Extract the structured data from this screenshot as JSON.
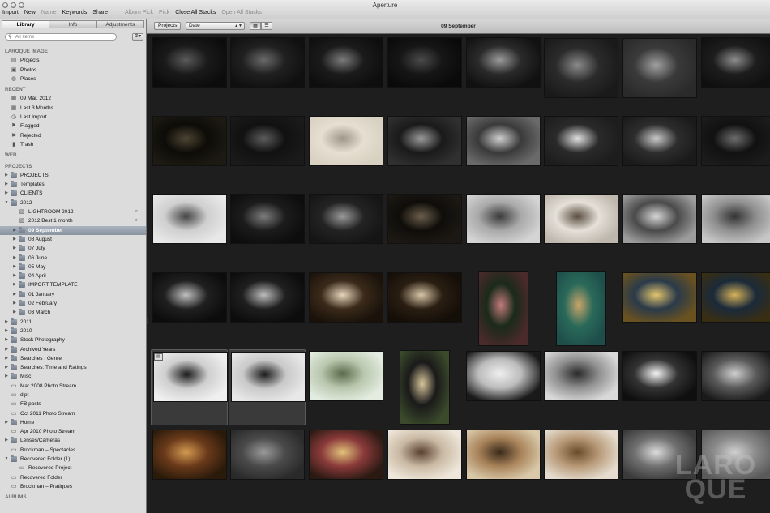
{
  "window": {
    "title": "Aperture"
  },
  "toolbar": [
    {
      "label": "Import",
      "enabled": true
    },
    {
      "label": "New",
      "enabled": true
    },
    {
      "label": "Name",
      "enabled": false
    },
    {
      "label": "Keywords",
      "enabled": true
    },
    {
      "label": "Share",
      "enabled": true
    },
    {
      "label": "Album Pick",
      "enabled": false
    },
    {
      "label": "Pick",
      "enabled": false
    },
    {
      "label": "Close All Stacks",
      "enabled": true
    },
    {
      "label": "Open All Stacks",
      "enabled": false
    }
  ],
  "sidebar": {
    "tabs": [
      {
        "label": "Library",
        "active": true
      },
      {
        "label": "Info",
        "active": false
      },
      {
        "label": "Adjustments",
        "active": false
      }
    ],
    "search_placeholder": "All Items",
    "action_icon": "gear-icon",
    "sections": [
      {
        "title": "LAROQUE IMAGE",
        "rows": [
          {
            "label": "Projects",
            "icon": "projects-icon",
            "indent": 0
          },
          {
            "label": "Photos",
            "icon": "photos-icon",
            "indent": 0
          },
          {
            "label": "Places",
            "icon": "globe-icon",
            "indent": 0
          }
        ]
      },
      {
        "title": "RECENT",
        "rows": [
          {
            "label": "09 Mar, 2012",
            "icon": "calendar-icon",
            "indent": 0
          },
          {
            "label": "Last 3 Months",
            "icon": "calendar-icon",
            "indent": 0
          },
          {
            "label": "Last Import",
            "icon": "clock-icon",
            "indent": 0
          },
          {
            "label": "Flagged",
            "icon": "flag-icon",
            "indent": 0
          },
          {
            "label": "Rejected",
            "icon": "x-icon",
            "indent": 0
          },
          {
            "label": "Trash",
            "icon": "trash-icon",
            "indent": 0
          }
        ]
      },
      {
        "title": "WEB",
        "rows": []
      },
      {
        "title": "PROJECTS",
        "rows": [
          {
            "label": "PROJECTS",
            "icon": "folder-icon",
            "indent": 0,
            "disclosure": "closed"
          },
          {
            "label": "Templates",
            "icon": "folder-icon",
            "indent": 0,
            "disclosure": "closed"
          },
          {
            "label": "CLIENTS",
            "icon": "folder-icon",
            "indent": 0,
            "disclosure": "closed"
          },
          {
            "label": "2012",
            "icon": "folder-icon",
            "indent": 0,
            "disclosure": "open"
          },
          {
            "label": "LIGHTROOM 2012",
            "icon": "smart-album-icon",
            "indent": 1,
            "search": true
          },
          {
            "label": "2012 Best 1 month",
            "icon": "smart-album-icon",
            "indent": 1,
            "search": true
          },
          {
            "label": "09 September",
            "icon": "folder-icon",
            "indent": 1,
            "disclosure": "closed",
            "selected": true
          },
          {
            "label": "08 August",
            "icon": "folder-icon",
            "indent": 1,
            "disclosure": "closed"
          },
          {
            "label": "07 July",
            "icon": "folder-icon",
            "indent": 1,
            "disclosure": "closed"
          },
          {
            "label": "06 June",
            "icon": "folder-icon",
            "indent": 1,
            "disclosure": "closed"
          },
          {
            "label": "05 May",
            "icon": "folder-icon",
            "indent": 1,
            "disclosure": "closed"
          },
          {
            "label": "04 April",
            "icon": "folder-icon",
            "indent": 1,
            "disclosure": "closed"
          },
          {
            "label": "IMPORT TEMPLATE",
            "icon": "folder-icon",
            "indent": 1,
            "disclosure": "closed"
          },
          {
            "label": "01 January",
            "icon": "folder-icon",
            "indent": 1,
            "disclosure": "closed"
          },
          {
            "label": "02 February",
            "icon": "folder-icon",
            "indent": 1,
            "disclosure": "closed"
          },
          {
            "label": "03 March",
            "icon": "folder-icon",
            "indent": 1,
            "disclosure": "closed"
          },
          {
            "label": "2011",
            "icon": "folder-icon",
            "indent": 0,
            "disclosure": "closed"
          },
          {
            "label": "2010",
            "icon": "folder-icon",
            "indent": 0,
            "disclosure": "closed"
          },
          {
            "label": "Stock Photography",
            "icon": "folder-icon",
            "indent": 0,
            "disclosure": "closed"
          },
          {
            "label": "Archived Years",
            "icon": "folder-icon",
            "indent": 0,
            "disclosure": "closed"
          },
          {
            "label": "Searches : Genre",
            "icon": "folder-icon",
            "indent": 0,
            "disclosure": "closed"
          },
          {
            "label": "Searches: Time and Ratings",
            "icon": "folder-icon",
            "indent": 0,
            "disclosure": "closed"
          },
          {
            "label": "Misc",
            "icon": "folder-icon",
            "indent": 0,
            "disclosure": "closed"
          },
          {
            "label": "Mar 2008 Photo Stream",
            "icon": "project-icon",
            "indent": 0
          },
          {
            "label": "dipt",
            "icon": "project-icon",
            "indent": 0
          },
          {
            "label": "FB posts",
            "icon": "project-icon",
            "indent": 0
          },
          {
            "label": "Oct 2011 Photo Stream",
            "icon": "project-icon",
            "indent": 0
          },
          {
            "label": "Home",
            "icon": "folder-icon",
            "indent": 0,
            "disclosure": "closed"
          },
          {
            "label": "Apr 2010 Photo Stream",
            "icon": "project-icon",
            "indent": 0
          },
          {
            "label": "Lenses/Cameras",
            "icon": "folder-icon",
            "indent": 0,
            "disclosure": "closed"
          },
          {
            "label": "Brockman – Spectacles",
            "icon": "project-icon",
            "indent": 0
          },
          {
            "label": "Recovered Folder (1)",
            "icon": "folder-icon",
            "indent": 0,
            "disclosure": "open"
          },
          {
            "label": "Recovered Project",
            "icon": "project-icon",
            "indent": 1
          },
          {
            "label": "Recovered Folder",
            "icon": "project-icon",
            "indent": 0
          },
          {
            "label": "Brockman – Pratiques",
            "icon": "project-icon",
            "indent": 0
          }
        ]
      },
      {
        "title": "ALBUMS",
        "rows": []
      }
    ]
  },
  "browser": {
    "projects_button": "Projects",
    "sort_value": "Date",
    "view_buttons": [
      {
        "icon": "grid-view-icon",
        "active": true
      },
      {
        "icon": "list-view-icon",
        "active": false
      }
    ],
    "folder_title": "09 September",
    "watermark": [
      "LARO",
      "QUE"
    ]
  },
  "thumbnails": [
    [
      {
        "orientation": "landscape",
        "tone": [
          "#0c0c0c",
          "#5a5a5a",
          "#1a1a1a"
        ]
      },
      {
        "orientation": "landscape",
        "tone": [
          "#101010",
          "#6a6a6a",
          "#202020"
        ]
      },
      {
        "orientation": "landscape",
        "tone": [
          "#0e0e0e",
          "#7b7b7b",
          "#1b1b1b"
        ]
      },
      {
        "orientation": "landscape",
        "tone": [
          "#0a0a0a",
          "#4a4a4a",
          "#161616"
        ]
      },
      {
        "orientation": "landscape",
        "tone": [
          "#111111",
          "#9a9a9a",
          "#2a2a2a"
        ]
      },
      {
        "orientation": "square",
        "tone": [
          "#1a1a1a",
          "#8a8a8a",
          "#2b2b2b"
        ]
      },
      {
        "orientation": "square",
        "tone": [
          "#2a2a2a",
          "#a0a0a0",
          "#3a3a3a"
        ]
      },
      {
        "orientation": "landscape",
        "tone": [
          "#101010",
          "#8d8d8d",
          "#1d1d1d"
        ]
      }
    ],
    [
      {
        "orientation": "landscape",
        "tone": [
          "#1c1a12",
          "#4d4432",
          "#0d0c08"
        ]
      },
      {
        "orientation": "landscape",
        "tone": [
          "#1a1a1a",
          "#5c5c5c",
          "#111111"
        ]
      },
      {
        "orientation": "landscape",
        "tone": [
          "#d8d0c0",
          "#9f968a",
          "#e6dfd2"
        ]
      },
      {
        "orientation": "landscape",
        "tone": [
          "#303030",
          "#9a9a9a",
          "#1a1a1a"
        ]
      },
      {
        "orientation": "landscape",
        "tone": [
          "#6a6a6a",
          "#cfcfcf",
          "#3a3a3a"
        ]
      },
      {
        "orientation": "landscape",
        "tone": [
          "#1d1d1d",
          "#e0e0e0",
          "#2a2a2a"
        ]
      },
      {
        "orientation": "landscape",
        "tone": [
          "#1a1a1a",
          "#c9c9c9",
          "#2d2d2d"
        ]
      },
      {
        "orientation": "landscape",
        "tone": [
          "#1c1c1c",
          "#6d6d6d",
          "#111111"
        ]
      }
    ],
    [
      {
        "orientation": "landscape",
        "tone": [
          "#e8e8e8",
          "#444444",
          "#cfcfcf"
        ]
      },
      {
        "orientation": "landscape",
        "tone": [
          "#0d0d0d",
          "#7d7d7d",
          "#1c1c1c"
        ]
      },
      {
        "orientation": "landscape",
        "tone": [
          "#151515",
          "#9a9a9a",
          "#232323"
        ]
      },
      {
        "orientation": "landscape",
        "tone": [
          "#1c1914",
          "#6b5e4c",
          "#0f0d0a"
        ]
      },
      {
        "orientation": "landscape",
        "tone": [
          "#d4d4d4",
          "#3a3a3a",
          "#a9a9a9"
        ]
      },
      {
        "orientation": "landscape",
        "tone": [
          "#bdb7ad",
          "#5a4e40",
          "#e5e0d8"
        ]
      },
      {
        "orientation": "landscape",
        "tone": [
          "#9c9c9c",
          "#d6d6d6",
          "#4a4a4a"
        ]
      },
      {
        "orientation": "landscape",
        "tone": [
          "#c7c7c7",
          "#333333",
          "#8f8f8f"
        ]
      }
    ],
    [
      {
        "orientation": "landscape",
        "tone": [
          "#0c0c0c",
          "#c0c0c0",
          "#202020"
        ]
      },
      {
        "orientation": "landscape",
        "tone": [
          "#0c0c0c",
          "#bdbdbd",
          "#1f1f1f"
        ]
      },
      {
        "orientation": "landscape",
        "tone": [
          "#1a120a",
          "#e8d7bd",
          "#3a2a1a"
        ]
      },
      {
        "orientation": "landscape",
        "tone": [
          "#140e08",
          "#d8c6a8",
          "#2a1e12"
        ]
      },
      {
        "orientation": "portrait",
        "tone": [
          "#4a2a2a",
          "#c07a7a",
          "#1a2a1a"
        ]
      },
      {
        "orientation": "portrait",
        "tone": [
          "#1e4d4a",
          "#c9a36a",
          "#2a6a5a"
        ]
      },
      {
        "orientation": "landscape",
        "tone": [
          "#6a5220",
          "#e3c56e",
          "#2a3a4a"
        ]
      },
      {
        "orientation": "landscape",
        "tone": [
          "#3a2e12",
          "#d6b258",
          "#1a2a3a"
        ]
      }
    ],
    [
      {
        "orientation": "landscape",
        "tone": [
          "#f0f0f0",
          "#1a1a1a",
          "#cfcfcf"
        ],
        "selected": true,
        "stack": true
      },
      {
        "orientation": "landscape",
        "tone": [
          "#e8e8e8",
          "#1a1a1a",
          "#c9c9c9"
        ],
        "selected": true
      },
      {
        "orientation": "landscape",
        "tone": [
          "#e3ece0",
          "#5a6a4a",
          "#b9c7ae"
        ]
      },
      {
        "orientation": "portrait",
        "tone": [
          "#3a4a2a",
          "#d7c49a",
          "#1a1a1a"
        ]
      },
      {
        "orientation": "landscape",
        "tone": [
          "#1a1a1a",
          "#efefef",
          "#bcbcbc"
        ]
      },
      {
        "orientation": "landscape",
        "tone": [
          "#d9d9d9",
          "#2a2a2a",
          "#909090"
        ]
      },
      {
        "orientation": "landscape",
        "tone": [
          "#0f0f0f",
          "#f4f4f4",
          "#333333"
        ]
      },
      {
        "orientation": "landscape",
        "tone": [
          "#1a1a1a",
          "#cfcfcf",
          "#5a5a5a"
        ]
      }
    ],
    [
      {
        "orientation": "landscape",
        "tone": [
          "#2a1a0a",
          "#d49a52",
          "#6a3a1a"
        ]
      },
      {
        "orientation": "landscape",
        "tone": [
          "#2a2a2a",
          "#9a9a9a",
          "#4a4a4a"
        ]
      },
      {
        "orientation": "landscape",
        "tone": [
          "#2a1a12",
          "#e2c27a",
          "#8a3a3a"
        ]
      },
      {
        "orientation": "landscape",
        "tone": [
          "#efe7db",
          "#5a4030",
          "#c9b9a3"
        ]
      },
      {
        "orientation": "landscape",
        "tone": [
          "#d9c9a9",
          "#3a2a1a",
          "#a9835a"
        ]
      },
      {
        "orientation": "landscape",
        "tone": [
          "#e5dccf",
          "#6a4a2a",
          "#b89a78"
        ]
      },
      {
        "orientation": "landscape",
        "tone": [
          "#3a3a3a",
          "#dcdcdc",
          "#707070"
        ]
      },
      {
        "orientation": "landscape",
        "tone": [
          "#5a5a5a",
          "#d0d0d0",
          "#8a8a8a"
        ]
      }
    ]
  ]
}
